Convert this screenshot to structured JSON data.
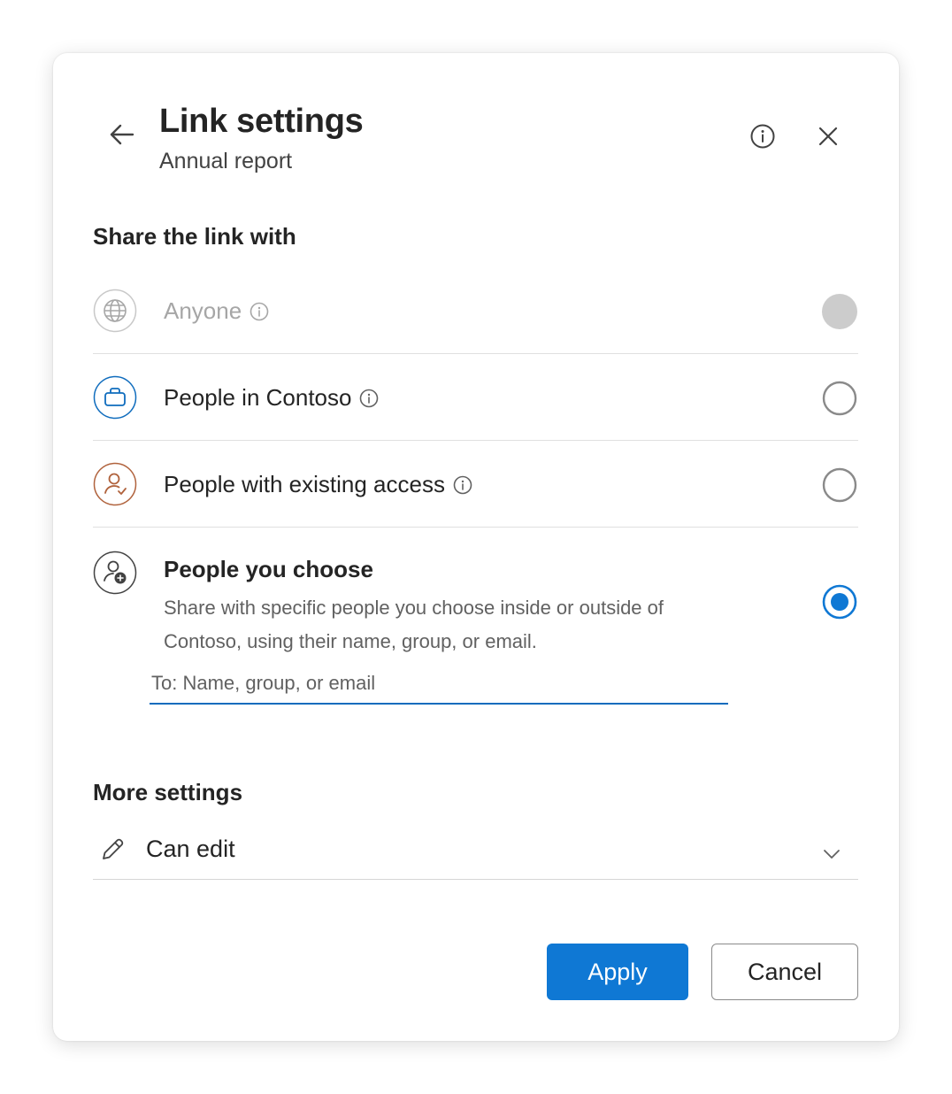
{
  "header": {
    "title": "Link settings",
    "subtitle": "Annual report"
  },
  "share": {
    "heading": "Share the link with",
    "options": [
      {
        "label": "Anyone",
        "icon": "globe-icon",
        "state": "disabled"
      },
      {
        "label": "People in Contoso",
        "icon": "briefcase-icon",
        "state": "unselected"
      },
      {
        "label": "People with existing access",
        "icon": "person-access-icon",
        "state": "unselected"
      },
      {
        "label": "People you choose",
        "description": "Share with specific people you choose inside or outside of Contoso, using their name, group, or email.",
        "icon": "person-add-icon",
        "state": "selected"
      }
    ],
    "to_placeholder": "To: Name, group, or email",
    "to_value": ""
  },
  "more_settings": {
    "heading": "More settings",
    "permission": "Can edit"
  },
  "buttons": {
    "apply": "Apply",
    "cancel": "Cancel"
  },
  "colors": {
    "accent": "#0f78d4",
    "contoso_icon": "#0f6cbd",
    "access_icon": "#b0623c",
    "disabled": "#a6a6a6"
  }
}
